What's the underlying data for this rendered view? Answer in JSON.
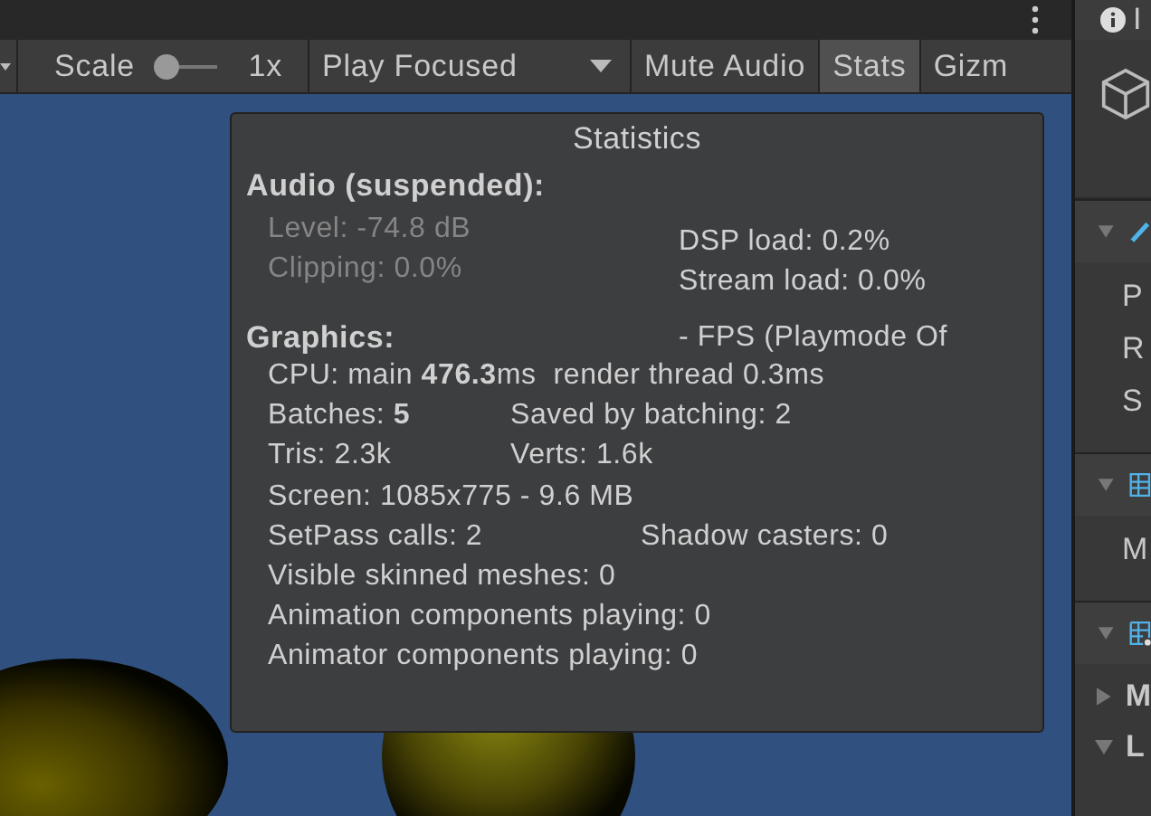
{
  "toolbar": {
    "scale": {
      "label": "Scale",
      "level": 0,
      "value": "1x"
    },
    "buttons": [
      {
        "kind": "dropdown",
        "label": "Play Focused"
      },
      {
        "kind": "toggle",
        "label": "Mute Audio",
        "selected": false
      },
      {
        "kind": "toggle",
        "label": "Stats",
        "selected": true
      },
      {
        "kind": "toggle",
        "label": "Gizm",
        "selected": false
      }
    ]
  },
  "statistics": {
    "title": "Statistics",
    "audio": {
      "heading": "Audio (suspended):",
      "left": [
        {
          "text": "Level: -74.8 dB",
          "disabled": true
        },
        {
          "text": "Clipping: 0.0%",
          "disabled": true
        }
      ],
      "right": [
        "DSP load: 0.2%",
        "Stream load: 0.0%"
      ]
    },
    "graphics": {
      "heading": "Graphics:",
      "fps": "- FPS (Playmode Of",
      "rows": [
        {
          "kind": "single",
          "cells": [
            "CPU: main **476.3**ms  render thread 0.3ms"
          ]
        },
        {
          "kind": "pair",
          "cells": [
            "Batches: **5**",
            "Saved by batching: 2"
          ]
        },
        {
          "kind": "pair",
          "cells": [
            "Tris: 2.3k",
            "Verts: 1.6k"
          ]
        },
        {
          "kind": "single",
          "cells": [
            "Screen: 1085x775 - 9.6 MB"
          ]
        },
        {
          "kind": "wide_pair",
          "cells": [
            "SetPass calls: 2",
            "Shadow casters: 0"
          ]
        },
        {
          "kind": "single",
          "cells": [
            "Visible skinned meshes: 0"
          ]
        },
        {
          "kind": "single",
          "cells": [
            "Animation components playing: 0"
          ]
        },
        {
          "kind": "single",
          "cells": [
            "Animator components playing: 0"
          ]
        }
      ]
    }
  },
  "inspector": {
    "tab": "I",
    "components": [
      {
        "kind": "transform",
        "expanded": true,
        "fields": [
          "P",
          "R",
          "S"
        ]
      },
      {
        "kind": "mesh_filter",
        "expanded": true,
        "fields": [
          "M"
        ]
      },
      {
        "kind": "mesh_renderer",
        "expanded": true,
        "children": [
          {
            "label": "M",
            "expanded": false
          },
          {
            "label": "L",
            "expanded": true
          }
        ]
      }
    ]
  }
}
